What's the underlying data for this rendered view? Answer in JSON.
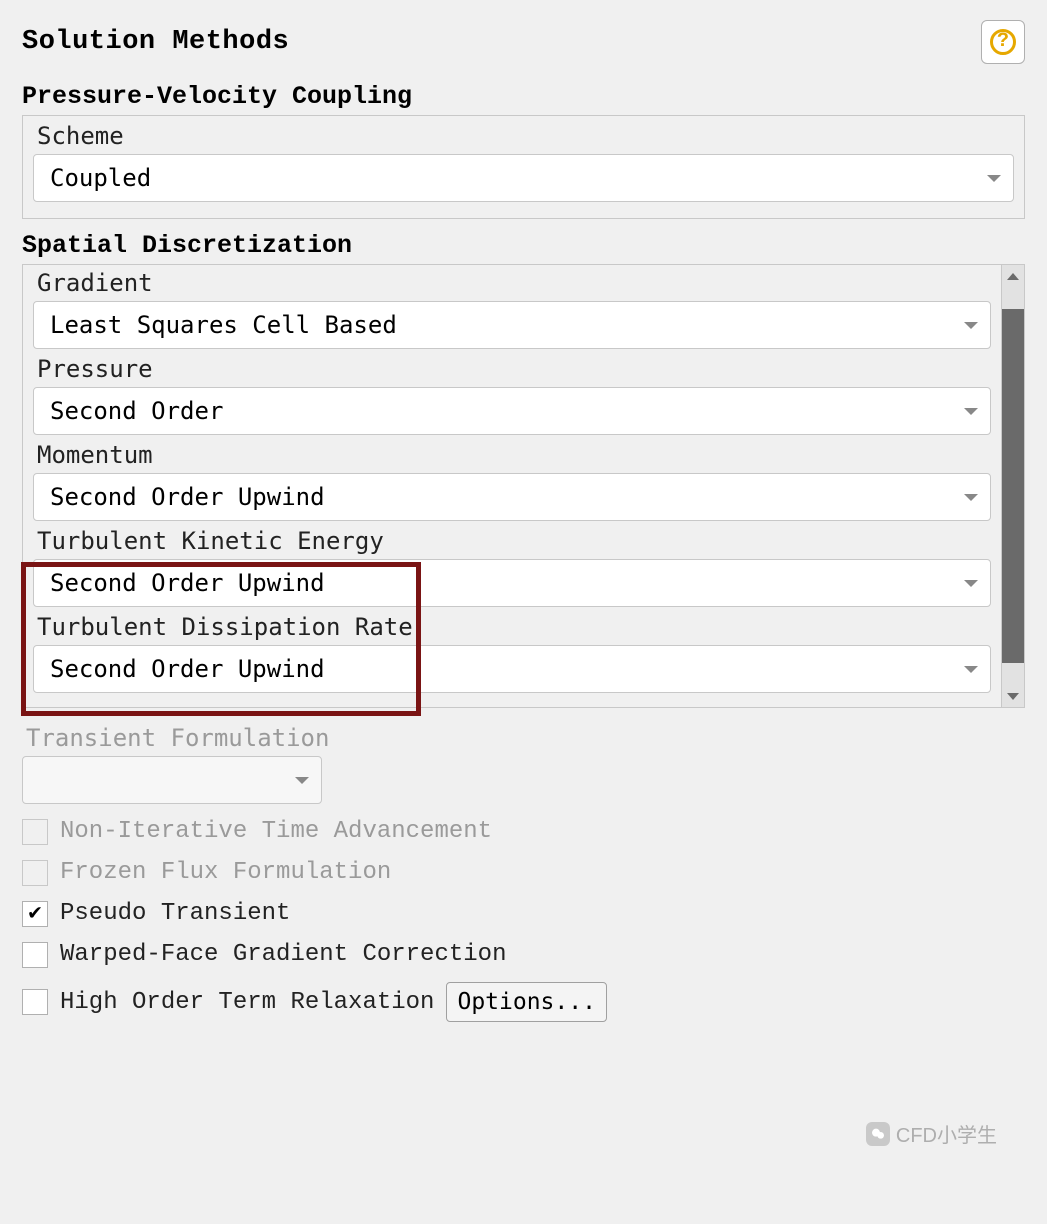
{
  "title": "Solution Methods",
  "help_icon": "?",
  "pressure_velocity_coupling": {
    "section_title": "Pressure-Velocity Coupling",
    "scheme_label": "Scheme",
    "scheme_value": "Coupled"
  },
  "spatial_discretization": {
    "section_title": "Spatial Discretization",
    "gradient_label": "Gradient",
    "gradient_value": "Least Squares Cell Based",
    "pressure_label": "Pressure",
    "pressure_value": "Second Order",
    "momentum_label": "Momentum",
    "momentum_value": "Second Order Upwind",
    "tke_label": "Turbulent Kinetic Energy",
    "tke_value": "Second Order Upwind",
    "tdr_label": "Turbulent Dissipation Rate",
    "tdr_value": "Second Order Upwind"
  },
  "transient_formulation": {
    "label": "Transient Formulation",
    "value": ""
  },
  "checkboxes": {
    "non_iterative_label": "Non-Iterative Time Advancement",
    "non_iterative_checked": false,
    "non_iterative_enabled": false,
    "frozen_flux_label": "Frozen Flux Formulation",
    "frozen_flux_checked": false,
    "frozen_flux_enabled": false,
    "pseudo_transient_label": "Pseudo Transient",
    "pseudo_transient_checked": true,
    "pseudo_transient_enabled": true,
    "warped_face_label": "Warped-Face Gradient Correction",
    "warped_face_checked": false,
    "warped_face_enabled": true,
    "high_order_label": "High Order Term Relaxation",
    "high_order_checked": false,
    "high_order_enabled": true
  },
  "options_button": "Options...",
  "watermark": "CFD小学生"
}
